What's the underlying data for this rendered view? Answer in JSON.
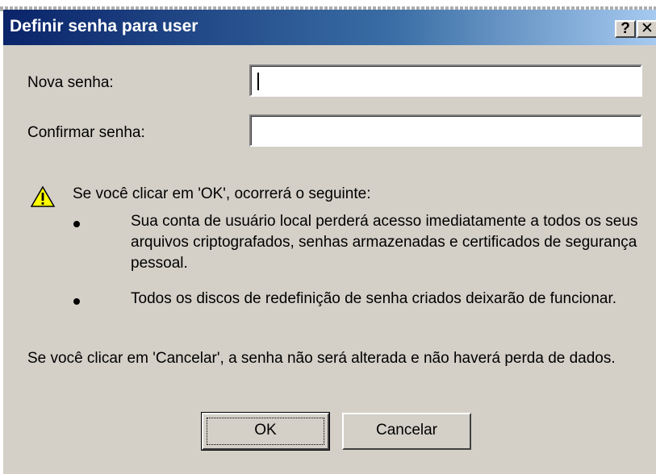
{
  "dialog": {
    "title": "Definir senha para user",
    "help_glyph": "?",
    "close_glyph": "✕"
  },
  "form": {
    "new_password_label": "Nova senha:",
    "confirm_password_label": "Confirmar senha:",
    "new_password_value": "",
    "confirm_password_value": ""
  },
  "warning": {
    "icon": "warning-icon",
    "intro": "Se você clicar em 'OK', ocorrerá o seguinte:",
    "bullets": [
      "Sua conta de usuário local perderá acesso imediatamente a todos os seus arquivos criptografados, senhas armazenadas e certificados de segurança pessoal.",
      "Todos os discos de redefinição de senha criados deixarão de funcionar."
    ]
  },
  "cancel_note": "Se você clicar em 'Cancelar', a senha não será alterada e não haverá perda de dados.",
  "buttons": {
    "ok": "OK",
    "cancel": "Cancelar"
  },
  "colors": {
    "title_bar_start": "#0a246a",
    "title_bar_end": "#a6caf0",
    "dialog_bg": "#d4d0c8",
    "warning_yellow": "#ffff00"
  }
}
